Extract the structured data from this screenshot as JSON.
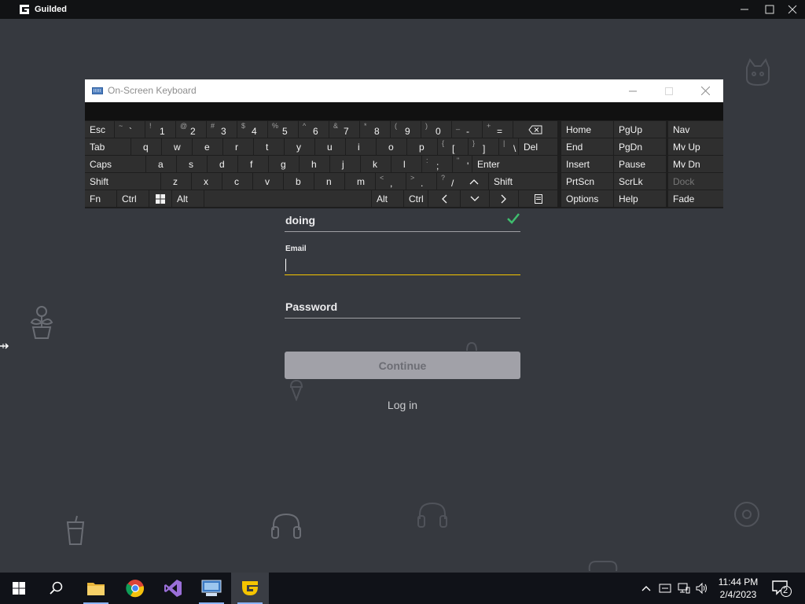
{
  "app": {
    "title": "Guilded"
  },
  "login": {
    "username_value": "doing",
    "email_label": "Email",
    "email_value": "",
    "password_placeholder": "Password",
    "continue_label": "Continue",
    "login_link": "Log in"
  },
  "osk": {
    "title": "On-Screen Keyboard",
    "rows": {
      "r1": [
        "Esc",
        "~ `",
        "! 1",
        "@ 2",
        "# 3",
        "$ 4",
        "% 5",
        "^ 6",
        "& 7",
        "* 8",
        "( 9",
        ") 0",
        "_ -",
        "+ =",
        "backspace-icon"
      ],
      "r2": [
        "Tab",
        "q",
        "w",
        "e",
        "r",
        "t",
        "y",
        "u",
        "i",
        "o",
        "p",
        "{ [",
        "} ]",
        "| \\",
        "Del"
      ],
      "r3": [
        "Caps",
        "a",
        "s",
        "d",
        "f",
        "g",
        "h",
        "j",
        "k",
        "l",
        ": ;",
        "\" '",
        "Enter"
      ],
      "r4": [
        "Shift",
        "z",
        "x",
        "c",
        "v",
        "b",
        "n",
        "m",
        "< ,",
        "> .",
        "? /",
        "up-arrow-icon",
        "Shift"
      ],
      "r5": [
        "Fn",
        "Ctrl",
        "windows-icon",
        "Alt",
        "",
        "Alt",
        "Ctrl",
        "left-arrow-icon",
        "down-arrow-icon",
        "right-arrow-icon",
        "menu-key-icon"
      ]
    },
    "nav": {
      "home": "Home",
      "pgup": "PgUp",
      "nav": "Nav",
      "end": "End",
      "pgdn": "PgDn",
      "mvup": "Mv Up",
      "insert": "Insert",
      "pause": "Pause",
      "mvdn": "Mv Dn",
      "prtscn": "PrtScn",
      "scrlk": "ScrLk",
      "dock": "Dock",
      "options": "Options",
      "help": "Help",
      "fade": "Fade"
    }
  },
  "taskbar": {
    "apps": [
      "windows-start-icon",
      "search-icon",
      "file-explorer-icon",
      "chrome-icon",
      "visual-studio-icon",
      "network-app-icon",
      "guilded-icon"
    ],
    "time": "11:44 PM",
    "date": "2/4/2023",
    "notifications": "2"
  },
  "colors": {
    "accent": "#f5c400",
    "background": "#36393f",
    "check": "#3fbd6e"
  }
}
